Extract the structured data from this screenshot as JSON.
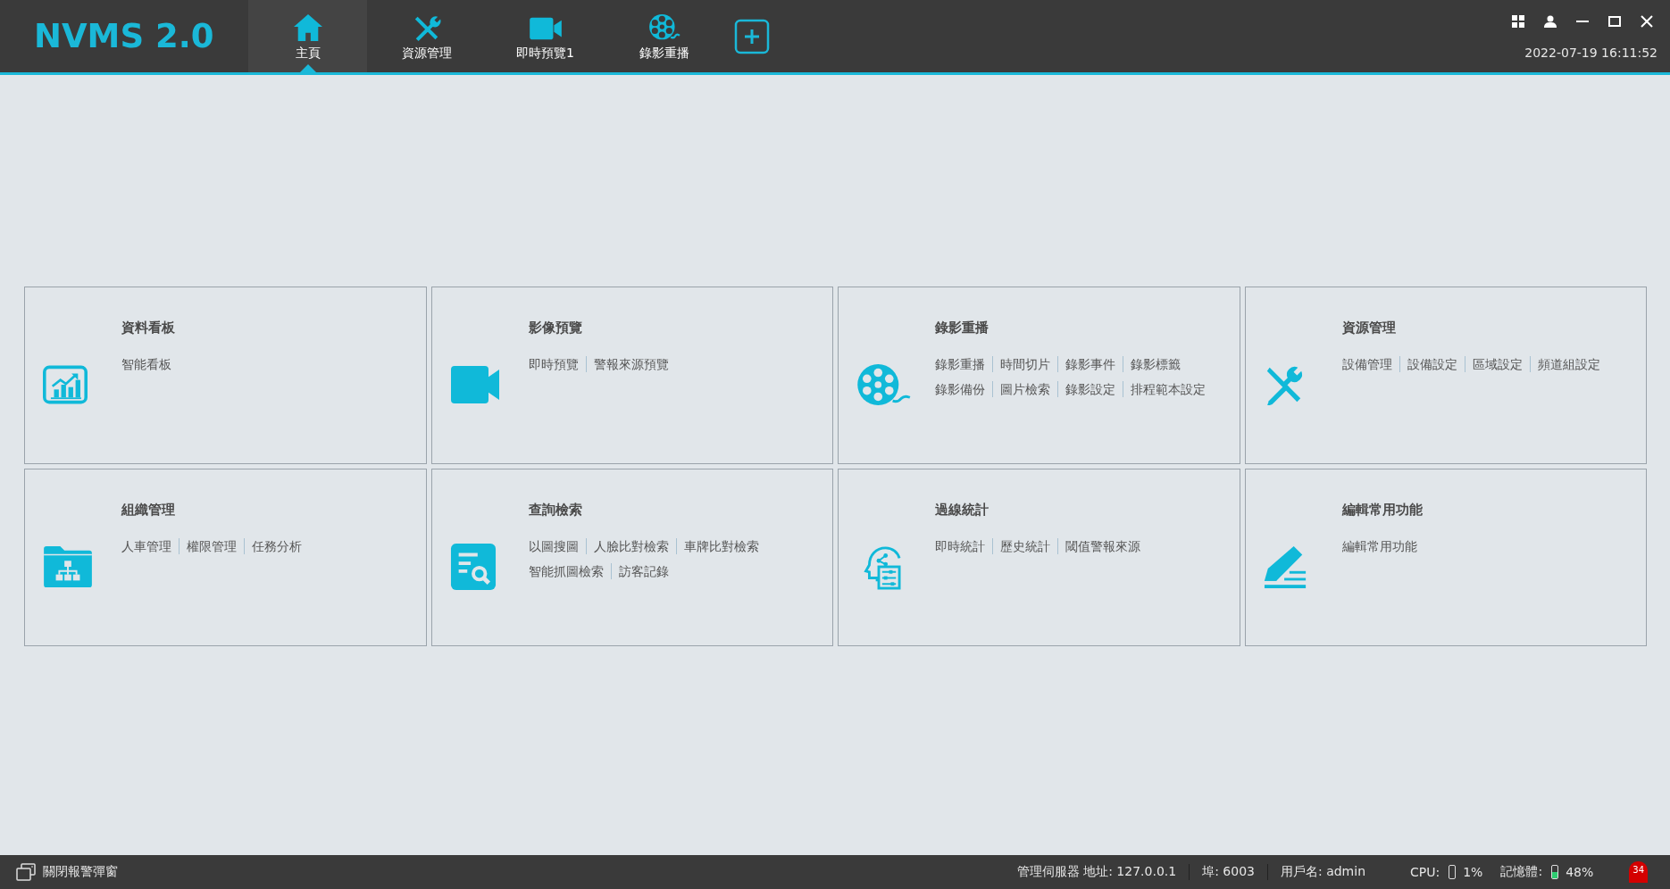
{
  "app": {
    "logo": "NVMS 2.0",
    "datetime": "2022-07-19 16:11:52"
  },
  "tabs": [
    {
      "label": "主頁",
      "kind": "home",
      "selected": true
    },
    {
      "label": "資源管理",
      "kind": "tools",
      "selected": false
    },
    {
      "label": "即時預覽1",
      "kind": "camera",
      "selected": false
    },
    {
      "label": "錄影重播",
      "kind": "film",
      "selected": false
    }
  ],
  "tiles": [
    {
      "title": "資料看板",
      "kind": "chart",
      "links": [
        [
          "智能看板"
        ]
      ]
    },
    {
      "title": "影像預覽",
      "kind": "camera",
      "links": [
        [
          "即時預覽",
          "警報來源預覽"
        ]
      ]
    },
    {
      "title": "錄影重播",
      "kind": "film",
      "links": [
        [
          "錄影重播",
          "時間切片",
          "錄影事件",
          "錄影標籤"
        ],
        [
          "錄影備份",
          "圖片檢索",
          "錄影設定",
          "排程範本設定"
        ]
      ]
    },
    {
      "title": "資源管理",
      "kind": "tools",
      "links": [
        [
          "設備管理",
          "設備設定",
          "區域設定",
          "頻道組設定"
        ]
      ]
    },
    {
      "title": "組織管理",
      "kind": "org",
      "links": [
        [
          "人車管理",
          "權限管理",
          "任務分析"
        ]
      ]
    },
    {
      "title": "查詢檢索",
      "kind": "search",
      "links": [
        [
          "以圖搜圖",
          "人臉比對檢索",
          "車牌比對檢索"
        ],
        [
          "智能抓圖檢索",
          "訪客記錄"
        ]
      ]
    },
    {
      "title": "過線統計",
      "kind": "stats",
      "links": [
        [
          "即時統計",
          "歷史統計",
          "閾值警報來源"
        ]
      ]
    },
    {
      "title": "編輯常用功能",
      "kind": "edit",
      "links": [
        [
          "編輯常用功能"
        ]
      ]
    }
  ],
  "status_bar": {
    "alarm_popup": "關閉報警彈窗",
    "server": "管理伺服器 地址: 127.0.0.1",
    "port": "埠: 6003",
    "user": "用戶名: admin",
    "cpu_label": "CPU:",
    "cpu": {
      "level": 0.01,
      "reading": "1%"
    },
    "memory_label": "記憶體:",
    "memory": {
      "level": 0.48,
      "reading": "48%"
    },
    "alarm_count": "34"
  }
}
